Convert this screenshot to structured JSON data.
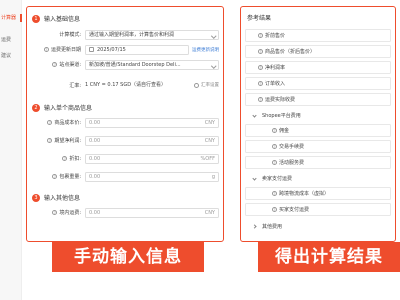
{
  "sidebar": {
    "items": [
      {
        "label": "计算器",
        "active": true
      },
      {
        "label": "运费",
        "active": false
      },
      {
        "label": "建议",
        "active": false
      }
    ]
  },
  "form": {
    "section1": {
      "num": "1",
      "title": "输入基础信息",
      "calc_mode_label": "计算模式:",
      "calc_mode_value": "通过输入期望利润率，计算售价和利润",
      "date_label": "运费更新日期",
      "date_value": "2025/07/15",
      "date_link": "运费更新说明",
      "site_label": "站点渠道:",
      "site_value": "新加坡/普通/Standard Doorstep Deli...",
      "rate_label": "汇率:",
      "rate_value": "1 CNY = 0.17 SGD（请自行查看）",
      "rate_option": "汇率设置"
    },
    "section2": {
      "num": "2",
      "title": "输入单个商品信息",
      "cost_label": "商品成本价:",
      "cost_placeholder": "0.00",
      "cost_unit": "CNY",
      "margin_label": "期望净利润:",
      "margin_placeholder": "0.00",
      "margin_unit": "CNY",
      "discount_label": "折扣:",
      "discount_placeholder": "0.00",
      "discount_unit": "%OFF",
      "weight_label": "包裹重量:",
      "weight_placeholder": "0.00",
      "weight_unit": "g"
    },
    "section3": {
      "num": "3",
      "title": "输入其他信息",
      "domestic_label": "境内运费:",
      "domestic_placeholder": "0.00",
      "domestic_unit": "CNY"
    }
  },
  "result": {
    "title": "参考结果",
    "rows": [
      {
        "label": "折前售价",
        "kind": "item"
      },
      {
        "label": "商品售价（折后售价）",
        "kind": "item"
      },
      {
        "label": "净利润率",
        "kind": "item"
      },
      {
        "label": "订单收入",
        "kind": "item"
      },
      {
        "label": "运费实际收费",
        "kind": "item"
      },
      {
        "label": "Shopee平台费用",
        "kind": "group"
      },
      {
        "label": "佣金",
        "kind": "sub"
      },
      {
        "label": "交易手续费",
        "kind": "sub"
      },
      {
        "label": "活动服务费",
        "kind": "sub"
      },
      {
        "label": "卖家支付运费",
        "kind": "group"
      },
      {
        "label": "跨境物流成本（虚拟）",
        "kind": "sub"
      },
      {
        "label": "买家支付运费",
        "kind": "sub"
      },
      {
        "label": "其他费用",
        "kind": "group"
      }
    ]
  },
  "banners": {
    "left": "手动输入信息",
    "right": "得出计算结果"
  },
  "colors": {
    "accent": "#ee4d2d",
    "link": "#3a7bd5"
  }
}
